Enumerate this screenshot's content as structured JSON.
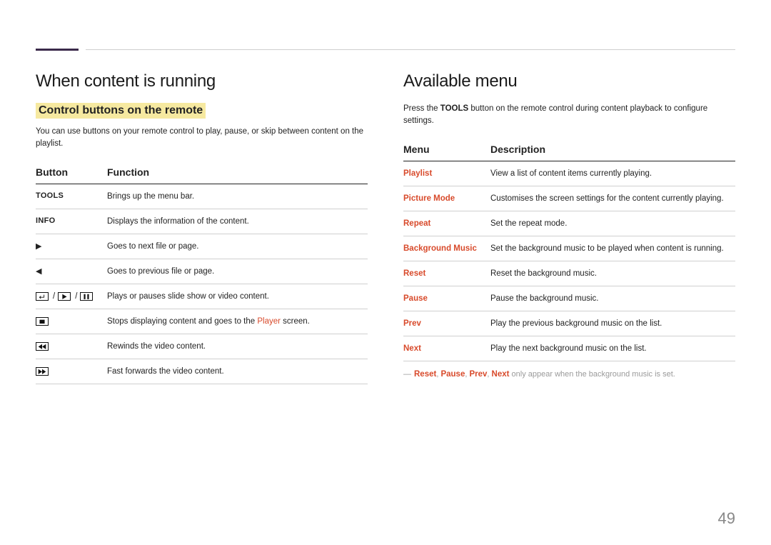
{
  "page_number": "49",
  "left": {
    "heading": "When content is running",
    "subheading": "Control buttons on the remote",
    "intro": "You can use buttons on your remote control to play, pause, or skip between content on the playlist.",
    "col_button": "Button",
    "col_function": "Function",
    "rows": {
      "tools": {
        "label": "TOOLS",
        "desc": "Brings up the menu bar."
      },
      "info": {
        "label": "INFO",
        "desc": "Displays the information of the content."
      },
      "right": {
        "desc": "Goes to next file or page."
      },
      "left": {
        "desc": "Goes to previous file or page."
      },
      "playpause": {
        "desc": "Plays or pauses slide show or video content."
      },
      "stop": {
        "desc_pre": "Stops displaying content and goes to the ",
        "link": "Player",
        "desc_post": " screen."
      },
      "rewind": {
        "desc": "Rewinds the video content."
      },
      "ffw": {
        "desc": "Fast forwards the video content."
      }
    }
  },
  "right": {
    "heading": "Available menu",
    "intro_pre": "Press the ",
    "intro_bold": "TOOLS",
    "intro_post": " button on the remote control during content playback to configure settings.",
    "col_menu": "Menu",
    "col_desc": "Description",
    "rows": {
      "playlist": {
        "name": "Playlist",
        "desc": "View a list of content items currently playing."
      },
      "picture": {
        "name": "Picture Mode",
        "desc": "Customises the screen settings for the content currently playing."
      },
      "repeat": {
        "name": "Repeat",
        "desc": "Set the repeat mode."
      },
      "bgm": {
        "name": "Background Music",
        "desc": "Set the background music to be played when content is running."
      },
      "reset": {
        "name": "Reset",
        "desc": "Reset the background music."
      },
      "pause": {
        "name": "Pause",
        "desc": "Pause the background music."
      },
      "prev": {
        "name": "Prev",
        "desc": "Play the previous background music on the list."
      },
      "next": {
        "name": "Next",
        "desc": "Play the next background music on the list."
      }
    },
    "footnote": {
      "dash": "―",
      "r1": "Reset",
      "c1": ", ",
      "r2": "Pause",
      "c2": ", ",
      "r3": "Prev",
      "c3": ", ",
      "r4": "Next",
      "rest": " only appear when the background music is set."
    }
  }
}
